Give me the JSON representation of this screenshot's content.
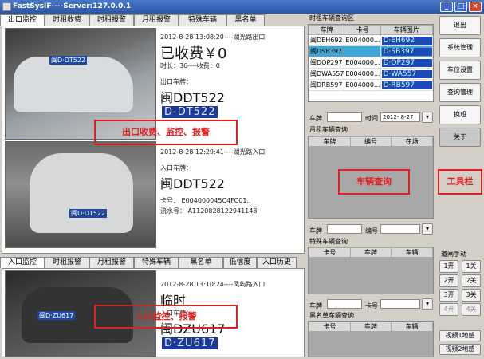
{
  "window": {
    "title": "FastSysIF----Server:127.0.0.1",
    "min": "_",
    "max": "□",
    "close": "×"
  },
  "top_tabs": [
    "出口监控",
    "时租收费",
    "时租报警",
    "月租报警",
    "特殊车辆",
    "黑名单"
  ],
  "exit_record": {
    "time": "2012-8-28 13:08:20----湖光路出口",
    "fee": "已收费￥0",
    "duration": "时长：36----收费：0",
    "plate_label": "出口车牌：",
    "plate": "闽DDT522",
    "plate_image": "D-DT522",
    "photo_plate": "闽D·DT522"
  },
  "entry_record": {
    "time": "2012-8-28 12:29:41----湖光路入口",
    "plate_label": "入口车牌：",
    "plate": "闽DDT522",
    "card": "卡号：      E004000045C4FC01,,",
    "serial": "流水号：  A1120828122941148",
    "photo_plate": "闽D·DT522"
  },
  "annot": {
    "exit": "出口收费、监控、报警",
    "vehicle_query": "车辆查询",
    "toolbar": "工具栏",
    "entry": "入口监控、报警"
  },
  "bottom_tabs": [
    "入口监控",
    "时租报警",
    "月租报警",
    "特殊车辆",
    "黑名单",
    "低信度",
    "入口历史"
  ],
  "entry_live": {
    "time": "2012-8-28 13:10:24----凤屿路入口",
    "status": "临时",
    "plate_label": "入口车牌：",
    "plate": "闽DZU617",
    "plate_image": "D·ZU617",
    "photo_plate": "闽D·ZU617"
  },
  "hourly_query": {
    "title": "时租车辆查询区",
    "columns": [
      "车牌",
      "卡号",
      "车辆图片"
    ],
    "rows": [
      {
        "plate": "闽DEH692",
        "card": "E004000...",
        "img": "D·EH692"
      },
      {
        "plate": "闽DSB397",
        "card": "",
        "img": "D·SB397"
      },
      {
        "plate": "闽DOP297",
        "card": "E004000...",
        "img": "D·OP297"
      },
      {
        "plate": "闽DWA557",
        "card": "E004000...",
        "img": "D·WA557"
      },
      {
        "plate": "闽DRB597",
        "card": "E004000...",
        "img": "D·RB597"
      }
    ],
    "plate_label": "车牌",
    "time_label": "时间",
    "date_value": "2012- 8-27"
  },
  "monthly_query": {
    "title": "月租车辆查询",
    "columns": [
      "车牌",
      "编号",
      "在场"
    ],
    "plate_label": "车牌",
    "number_label": "编号"
  },
  "special_query": {
    "title": "特殊车辆查询",
    "columns": [
      "卡号",
      "车牌",
      "车辆"
    ],
    "plate_label": "车牌",
    "card_label": "卡号"
  },
  "blacklist_query": {
    "title": "黑名单车辆查询",
    "columns": [
      "卡号",
      "车牌",
      "车辆"
    ]
  },
  "sidebar": {
    "buttons": [
      "退出",
      "系统管理",
      "车位设置",
      "查询管理",
      "换班",
      "关于"
    ],
    "gate_title": "道闸手动",
    "gates": [
      [
        "1开",
        "1关"
      ],
      [
        "2开",
        "2关"
      ],
      [
        "3开",
        "3关"
      ],
      [
        "4开",
        "4关"
      ]
    ],
    "video": [
      "视频1地感",
      "视频2地感"
    ]
  },
  "colors": {
    "accent_red": "#e02020",
    "header_blue": "#2a56a8"
  }
}
